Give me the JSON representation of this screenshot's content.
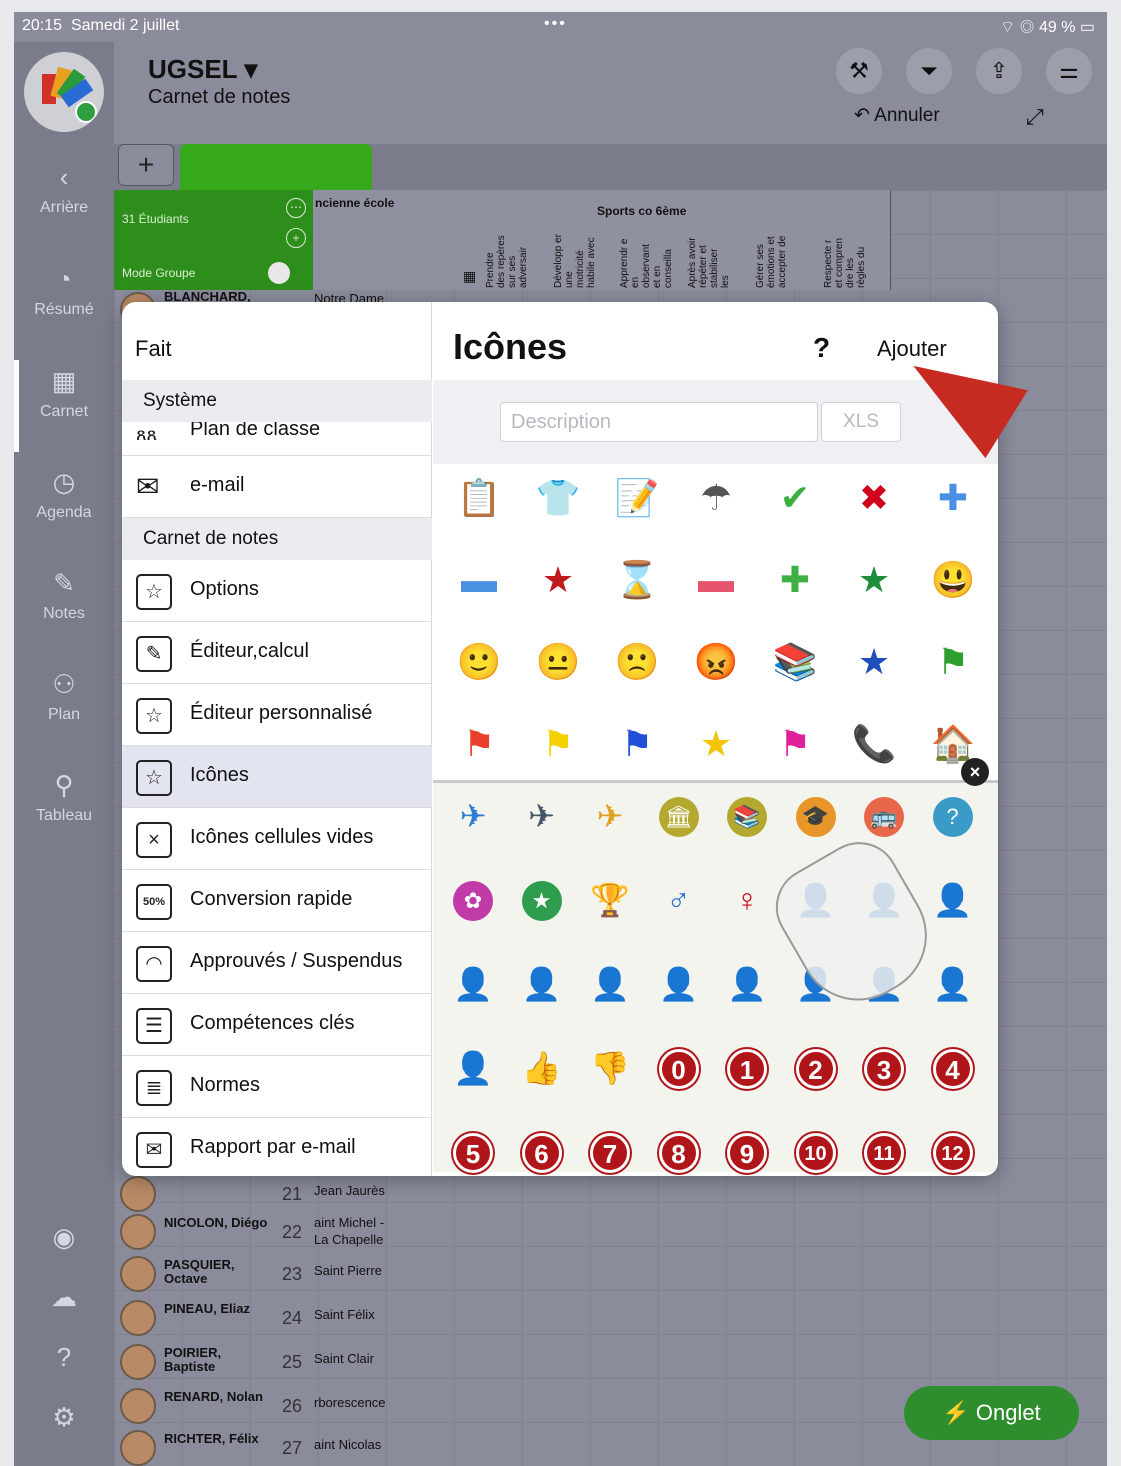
{
  "status_bar": {
    "time": "20:15",
    "date": "Samedi 2 juillet",
    "battery": "49 %"
  },
  "sidebar": {
    "items": [
      {
        "label": "Arrière",
        "icon": "chevron-left-icon"
      },
      {
        "label": "Résumé",
        "icon": "pie-chart-icon"
      },
      {
        "label": "Carnet",
        "icon": "grid-icon"
      },
      {
        "label": "Agenda",
        "icon": "clock-icon"
      },
      {
        "label": "Notes",
        "icon": "pencil-icon"
      },
      {
        "label": "Plan",
        "icon": "people-icon"
      },
      {
        "label": "Tableau",
        "icon": "pin-icon"
      }
    ]
  },
  "header": {
    "title": "UGSEL ▾",
    "subtitle": "Carnet de notes",
    "undo_label": "Annuler"
  },
  "grid": {
    "students_count": "31 Étudiants",
    "group_mode": "Mode Groupe",
    "col_ancienne": "ncienne école",
    "col_sports": "Sports co 6ème",
    "competences": [
      "Prendre des repères sur ses adversair",
      "Développ er une motricité habile avec",
      "Apprendr e en observant et en conseilla",
      "Après avoir répéter et stabiliser les",
      "Gérer ses émotions et accepter de",
      "Respecte r et compren dre les règles du"
    ],
    "first_student": "BLANCHARD,",
    "first_school": "Notre Dame",
    "students": [
      {
        "name": "",
        "num": "21",
        "school": "Jean Jaurès"
      },
      {
        "name": "NICOLON, Diégo",
        "num": "22",
        "school": "aint Michel - La Chapelle"
      },
      {
        "name": "PASQUIER, Octave",
        "num": "23",
        "school": "Saint Pierre"
      },
      {
        "name": "PINEAU, Eliaz",
        "num": "24",
        "school": "Saint Félix"
      },
      {
        "name": "POIRIER, Baptiste",
        "num": "25",
        "school": "Saint Clair"
      },
      {
        "name": "RENARD, Nolan",
        "num": "26",
        "school": "rborescence"
      },
      {
        "name": "RICHTER, Félix",
        "num": "27",
        "school": "aint Nicolas"
      }
    ]
  },
  "popup": {
    "done_label": "Fait",
    "section_system": "Système",
    "plan_label": "Plan de classe",
    "email_label": "e-mail",
    "section_notebook": "Carnet de notes",
    "menu": [
      {
        "label": "Options",
        "icon": "star-doc-icon",
        "glyph": "☆"
      },
      {
        "label": "Éditeur,calcul",
        "icon": "edit-doc-icon",
        "glyph": "✎"
      },
      {
        "label": "Éditeur personnalisé",
        "icon": "star-edit-doc-icon",
        "glyph": "☆"
      },
      {
        "label": "Icônes",
        "icon": "star-square-icon",
        "glyph": "☆"
      },
      {
        "label": "Icônes cellules vides",
        "icon": "x-square-icon",
        "glyph": "×"
      },
      {
        "label": "Conversion rapide",
        "icon": "percent-icon",
        "glyph": "50%"
      },
      {
        "label": "Approuvés / Suspendus",
        "icon": "gauge-icon",
        "glyph": "◠"
      },
      {
        "label": "Compétences clés",
        "icon": "bars-icon",
        "glyph": "☰"
      },
      {
        "label": "Normes",
        "icon": "list-icon",
        "glyph": "≣"
      },
      {
        "label": "Rapport par e-mail",
        "icon": "mail-doc-icon",
        "glyph": "✉"
      }
    ],
    "title": "Icônes",
    "help": "?",
    "add_label": "Ajouter",
    "description_placeholder": "Description",
    "xls_label": "XLS",
    "icon_rows": [
      [
        "📋",
        "👕",
        "📝",
        "☂",
        "✔",
        "✖",
        "✚"
      ],
      [
        "▬",
        "★",
        "⌛",
        "▬",
        "✚",
        "★",
        "😃"
      ],
      [
        "🙂",
        "😐",
        "🙁",
        "😡",
        "📚",
        "★",
        "⚑"
      ],
      [
        "⚑",
        "⚑",
        "⚑",
        "★",
        "⚑",
        "📞",
        "🏠"
      ]
    ],
    "icon_colors": [
      [
        "#555",
        "#2e8e4e",
        "#888",
        "#555",
        "#3cb043",
        "#d0021b",
        "#4a90e2"
      ],
      [
        "#4a90e2",
        "#c0191b",
        "#a06a2a",
        "#e5546d",
        "#3cb043",
        "#1f8e3a",
        "#1f8e3a"
      ],
      [
        "#7ac943",
        "#f6c343",
        "#f08a24",
        "#d0021b",
        "#e0522a",
        "#1f4fb8",
        "#2e9e2e"
      ],
      [
        "#e8402a",
        "#f5d000",
        "#1f4fd8",
        "#f5c400",
        "#e0209a",
        "#222",
        "#d0021b"
      ]
    ],
    "extra_rows": [
      [
        "✈",
        "✈",
        "✈",
        "🏛",
        "📚",
        "🎓",
        "🚌",
        "?"
      ],
      [
        "✿",
        "★",
        "🏆",
        "♂",
        "♀",
        "👤",
        "👤",
        "👤"
      ],
      [
        "👤",
        "👤",
        "👤",
        "👤",
        "👤",
        "👤",
        "👤",
        "👤"
      ],
      [
        "👤",
        "👍",
        "👎",
        "0",
        "1",
        "2",
        "3",
        "4"
      ],
      [
        "5",
        "6",
        "7",
        "8",
        "9",
        "10",
        "11",
        "12"
      ]
    ],
    "extra_colors": [
      [
        "#2a7fd4",
        "#456",
        "#e0a020",
        "#b5a830",
        "#b5a830",
        "#e8962a",
        "#e8664a",
        "#3a9ac8"
      ],
      [
        "#c03aa8",
        "#2e9e4e",
        "#c8a020",
        "#2a6ad4",
        "#d0021b",
        "#222",
        "#2a6ad4",
        "#3cab2e"
      ],
      [
        "#b040c0",
        "#d02a2a",
        "#f0a020",
        "#222",
        "#3a8ad4",
        "#3cab2e",
        "#777",
        "#d02a2a"
      ],
      [
        "#f0a020",
        "#2a6ad4",
        "#b01519",
        "#b01519",
        "#b01519",
        "#b01519",
        "#b01519",
        "#b01519"
      ],
      [
        "#b01519",
        "#b01519",
        "#b01519",
        "#b01519",
        "#b01519",
        "#b01519",
        "#b01519",
        "#b01519"
      ]
    ]
  },
  "fab": {
    "label": "Onglet"
  }
}
